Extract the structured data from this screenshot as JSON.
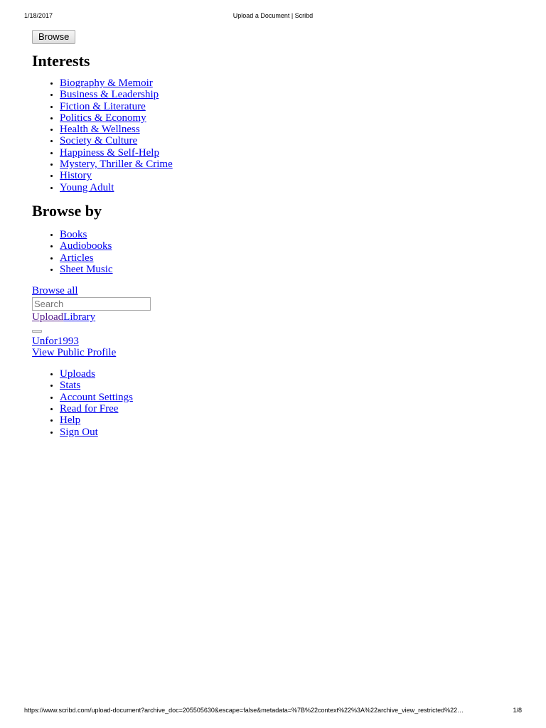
{
  "print_header": {
    "date": "1/18/2017",
    "title": "Upload a Document | Scribd"
  },
  "print_footer": {
    "url": "https://www.scribd.com/upload-document?archive_doc=205505630&escape=false&metadata=%7B%22context%22%3A%22archive_view_restricted%22…",
    "page": "1/8"
  },
  "browse_button_label": "Browse",
  "interests": {
    "heading": "Interests",
    "items": [
      "Biography & Memoir",
      "Business & Leadership",
      "Fiction & Literature",
      "Politics & Economy",
      "Health & Wellness",
      "Society & Culture",
      "Happiness & Self-Help",
      "Mystery, Thriller & Crime",
      "History",
      "Young Adult"
    ]
  },
  "browse_by": {
    "heading": "Browse by",
    "items": [
      "Books",
      "Audiobooks",
      "Articles",
      "Sheet Music"
    ]
  },
  "browse_all": "Browse all",
  "search": {
    "placeholder": "Search"
  },
  "upload_link": "Upload",
  "library_link": "Library",
  "user": {
    "name": "Unfor1993",
    "view_profile": "View Public Profile"
  },
  "account_menu": {
    "items": [
      "Uploads",
      "Stats",
      "Account Settings",
      "Read for Free",
      "Help",
      "Sign Out"
    ]
  },
  "colors": {
    "link": "#0000ee",
    "visited_link": "#551a8b",
    "text": "#000000",
    "background": "#ffffff"
  }
}
